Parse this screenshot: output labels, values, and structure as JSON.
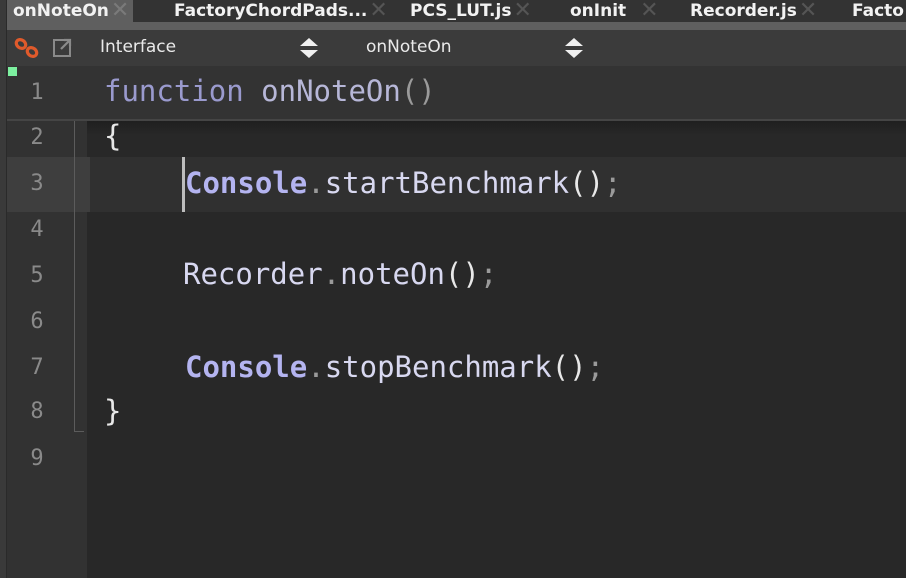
{
  "tabs": [
    {
      "label": "onNoteOn",
      "active": true
    },
    {
      "label": "FactoryChordPads...",
      "active": false
    },
    {
      "label": "PCS_LUT.js",
      "active": false
    },
    {
      "label": "onInit",
      "active": false
    },
    {
      "label": "Recorder.js",
      "active": false
    },
    {
      "label": "Facto",
      "active": false
    }
  ],
  "toolbar": {
    "link_icon": "chain-link-icon",
    "popout_icon": "external-window-icon",
    "namespace_selector": "Interface",
    "callback_selector": "onNoteOn"
  },
  "editor": {
    "active_line": 3,
    "lines": [
      {
        "number": "1",
        "tokens": [
          "function",
          " ",
          "onNoteOn",
          "()"
        ]
      },
      {
        "number": "2",
        "tokens": [
          "{"
        ]
      },
      {
        "number": "3",
        "tokens": [
          "Console",
          ".",
          "startBenchmark",
          "()",
          ";"
        ]
      },
      {
        "number": "4",
        "tokens": []
      },
      {
        "number": "5",
        "tokens": [
          "Recorder",
          ".",
          "noteOn",
          "()",
          ";"
        ]
      },
      {
        "number": "6",
        "tokens": []
      },
      {
        "number": "7",
        "tokens": [
          "Console",
          ".",
          "stopBenchmark",
          "()",
          ";"
        ]
      },
      {
        "number": "8",
        "tokens": [
          "}"
        ]
      },
      {
        "number": "9",
        "tokens": []
      }
    ]
  },
  "colors": {
    "keyword": "#9a9ace",
    "object": "#b4b4f0",
    "identifier": "#d8d8f0",
    "link_icon": "#e05a2b",
    "marker": "#7df0a0"
  }
}
